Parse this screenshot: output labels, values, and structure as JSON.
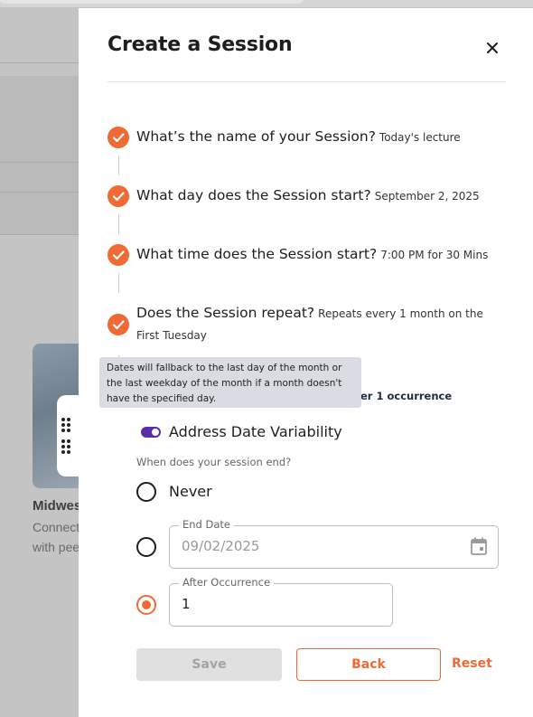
{
  "background": {
    "card": {
      "title": "Midwest",
      "text_line_1": "Connect",
      "text_line_2": "with peers"
    }
  },
  "dialog": {
    "title": "Create a Session",
    "steps": [
      {
        "question": "What’s the name of your Session?",
        "answer": "Today's lecture"
      },
      {
        "question": "What day does the Session start?",
        "answer": "September 2, 2025"
      },
      {
        "question": "What time does the Session start?",
        "answer": "7:00 PM for 30 Mins"
      },
      {
        "question": "Does the Session repeat?",
        "answer": "Repeats every 1 month on the",
        "answer_line_2": "First Tuesday"
      }
    ],
    "occurrence_summary": "er 1 occurrence",
    "tooltip": {
      "lines": [
        "Dates will fallback to the last day of the month or",
        "the last weekday of the month if a month doesn't",
        "have the specified day."
      ]
    },
    "toggle": {
      "label": "Address Date Variability",
      "on": true
    },
    "end_question": "When does your session end?",
    "end_options": {
      "never": {
        "label": "Never",
        "selected": false
      },
      "end_date": {
        "label": "End Date",
        "value": "09/02/2025",
        "selected": false,
        "disabled": true
      },
      "after_occurrence": {
        "label": "After Occurrence",
        "value": "1",
        "selected": true
      }
    },
    "buttons": {
      "save": "Save",
      "back": "Back",
      "reset": "Reset"
    }
  },
  "colors": {
    "accent": "#ef6a34",
    "toggle": "#5b2ea6",
    "overlay": "#c4c4c4"
  }
}
